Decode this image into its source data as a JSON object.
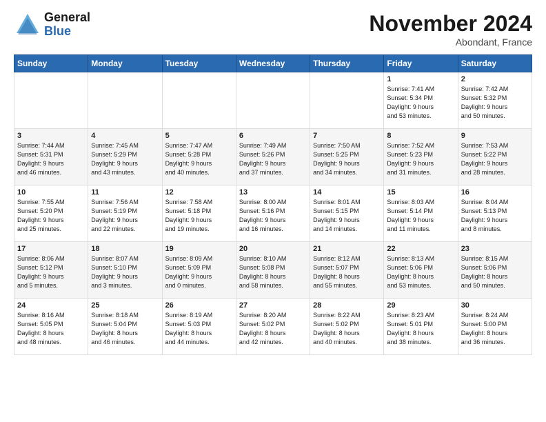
{
  "header": {
    "logo_general": "General",
    "logo_blue": "Blue",
    "month_title": "November 2024",
    "location": "Abondant, France"
  },
  "weekdays": [
    "Sunday",
    "Monday",
    "Tuesday",
    "Wednesday",
    "Thursday",
    "Friday",
    "Saturday"
  ],
  "weeks": [
    [
      {
        "day": "",
        "info": ""
      },
      {
        "day": "",
        "info": ""
      },
      {
        "day": "",
        "info": ""
      },
      {
        "day": "",
        "info": ""
      },
      {
        "day": "",
        "info": ""
      },
      {
        "day": "1",
        "info": "Sunrise: 7:41 AM\nSunset: 5:34 PM\nDaylight: 9 hours\nand 53 minutes."
      },
      {
        "day": "2",
        "info": "Sunrise: 7:42 AM\nSunset: 5:32 PM\nDaylight: 9 hours\nand 50 minutes."
      }
    ],
    [
      {
        "day": "3",
        "info": "Sunrise: 7:44 AM\nSunset: 5:31 PM\nDaylight: 9 hours\nand 46 minutes."
      },
      {
        "day": "4",
        "info": "Sunrise: 7:45 AM\nSunset: 5:29 PM\nDaylight: 9 hours\nand 43 minutes."
      },
      {
        "day": "5",
        "info": "Sunrise: 7:47 AM\nSunset: 5:28 PM\nDaylight: 9 hours\nand 40 minutes."
      },
      {
        "day": "6",
        "info": "Sunrise: 7:49 AM\nSunset: 5:26 PM\nDaylight: 9 hours\nand 37 minutes."
      },
      {
        "day": "7",
        "info": "Sunrise: 7:50 AM\nSunset: 5:25 PM\nDaylight: 9 hours\nand 34 minutes."
      },
      {
        "day": "8",
        "info": "Sunrise: 7:52 AM\nSunset: 5:23 PM\nDaylight: 9 hours\nand 31 minutes."
      },
      {
        "day": "9",
        "info": "Sunrise: 7:53 AM\nSunset: 5:22 PM\nDaylight: 9 hours\nand 28 minutes."
      }
    ],
    [
      {
        "day": "10",
        "info": "Sunrise: 7:55 AM\nSunset: 5:20 PM\nDaylight: 9 hours\nand 25 minutes."
      },
      {
        "day": "11",
        "info": "Sunrise: 7:56 AM\nSunset: 5:19 PM\nDaylight: 9 hours\nand 22 minutes."
      },
      {
        "day": "12",
        "info": "Sunrise: 7:58 AM\nSunset: 5:18 PM\nDaylight: 9 hours\nand 19 minutes."
      },
      {
        "day": "13",
        "info": "Sunrise: 8:00 AM\nSunset: 5:16 PM\nDaylight: 9 hours\nand 16 minutes."
      },
      {
        "day": "14",
        "info": "Sunrise: 8:01 AM\nSunset: 5:15 PM\nDaylight: 9 hours\nand 14 minutes."
      },
      {
        "day": "15",
        "info": "Sunrise: 8:03 AM\nSunset: 5:14 PM\nDaylight: 9 hours\nand 11 minutes."
      },
      {
        "day": "16",
        "info": "Sunrise: 8:04 AM\nSunset: 5:13 PM\nDaylight: 9 hours\nand 8 minutes."
      }
    ],
    [
      {
        "day": "17",
        "info": "Sunrise: 8:06 AM\nSunset: 5:12 PM\nDaylight: 9 hours\nand 5 minutes."
      },
      {
        "day": "18",
        "info": "Sunrise: 8:07 AM\nSunset: 5:10 PM\nDaylight: 9 hours\nand 3 minutes."
      },
      {
        "day": "19",
        "info": "Sunrise: 8:09 AM\nSunset: 5:09 PM\nDaylight: 9 hours\nand 0 minutes."
      },
      {
        "day": "20",
        "info": "Sunrise: 8:10 AM\nSunset: 5:08 PM\nDaylight: 8 hours\nand 58 minutes."
      },
      {
        "day": "21",
        "info": "Sunrise: 8:12 AM\nSunset: 5:07 PM\nDaylight: 8 hours\nand 55 minutes."
      },
      {
        "day": "22",
        "info": "Sunrise: 8:13 AM\nSunset: 5:06 PM\nDaylight: 8 hours\nand 53 minutes."
      },
      {
        "day": "23",
        "info": "Sunrise: 8:15 AM\nSunset: 5:06 PM\nDaylight: 8 hours\nand 50 minutes."
      }
    ],
    [
      {
        "day": "24",
        "info": "Sunrise: 8:16 AM\nSunset: 5:05 PM\nDaylight: 8 hours\nand 48 minutes."
      },
      {
        "day": "25",
        "info": "Sunrise: 8:18 AM\nSunset: 5:04 PM\nDaylight: 8 hours\nand 46 minutes."
      },
      {
        "day": "26",
        "info": "Sunrise: 8:19 AM\nSunset: 5:03 PM\nDaylight: 8 hours\nand 44 minutes."
      },
      {
        "day": "27",
        "info": "Sunrise: 8:20 AM\nSunset: 5:02 PM\nDaylight: 8 hours\nand 42 minutes."
      },
      {
        "day": "28",
        "info": "Sunrise: 8:22 AM\nSunset: 5:02 PM\nDaylight: 8 hours\nand 40 minutes."
      },
      {
        "day": "29",
        "info": "Sunrise: 8:23 AM\nSunset: 5:01 PM\nDaylight: 8 hours\nand 38 minutes."
      },
      {
        "day": "30",
        "info": "Sunrise: 8:24 AM\nSunset: 5:00 PM\nDaylight: 8 hours\nand 36 minutes."
      }
    ]
  ]
}
